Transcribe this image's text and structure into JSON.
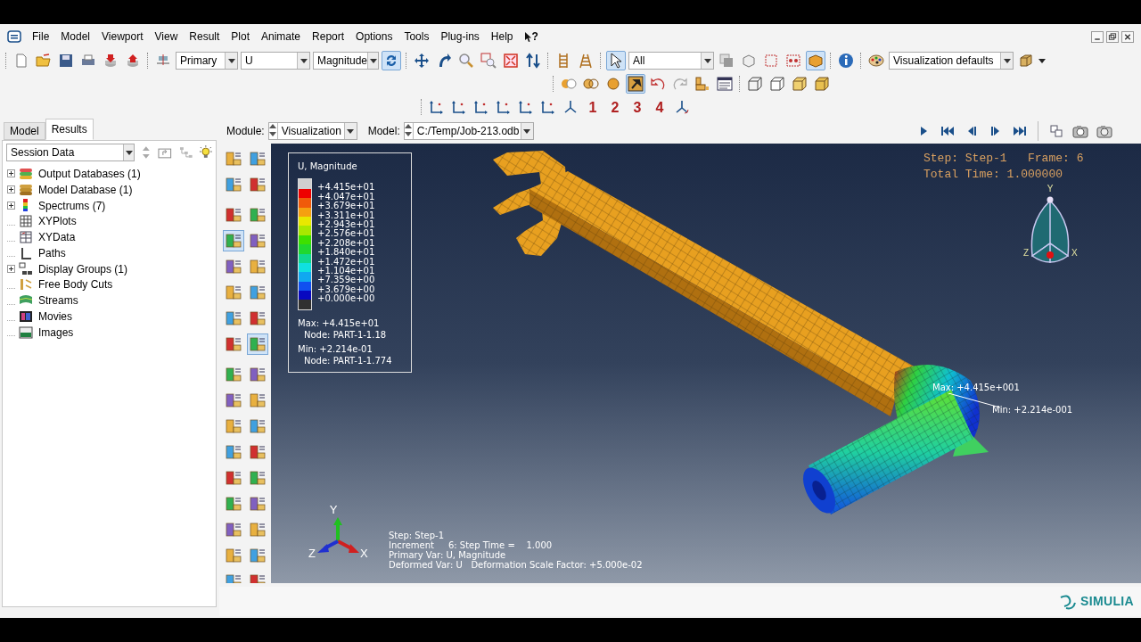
{
  "menu_bar": {
    "items": [
      "File",
      "Model",
      "Viewport",
      "View",
      "Result",
      "Plot",
      "Animate",
      "Report",
      "Options",
      "Tools",
      "Plug-ins",
      "Help"
    ],
    "help_mark": "?"
  },
  "toolbar": {
    "result_option": "Primary",
    "field": "U",
    "invariant": "Magnitude",
    "selection_filter": "All",
    "view_options": "Visualization defaults",
    "viewport_numbers": [
      "1",
      "2",
      "3",
      "4"
    ]
  },
  "context_bar": {
    "module_label": "Module:",
    "module": "Visualization",
    "model_label": "Model:",
    "model": "C:/Temp/Job-213.odb"
  },
  "tabs": [
    {
      "label": "Model",
      "selected": false
    },
    {
      "label": "Results",
      "selected": true
    }
  ],
  "tree": {
    "filter": "Session Data",
    "items": [
      {
        "label": "Output Databases (1)",
        "expandable": true
      },
      {
        "label": "Model Database (1)",
        "expandable": true
      },
      {
        "label": "Spectrums (7)",
        "expandable": true
      },
      {
        "label": "XYPlots",
        "expandable": false
      },
      {
        "label": "XYData",
        "expandable": false
      },
      {
        "label": "Paths",
        "expandable": false
      },
      {
        "label": "Display Groups (1)",
        "expandable": true
      },
      {
        "label": "Free Body Cuts",
        "expandable": false
      },
      {
        "label": "Streams",
        "expandable": false
      },
      {
        "label": "Movies",
        "expandable": false
      },
      {
        "label": "Images",
        "expandable": false
      }
    ]
  },
  "viewport": {
    "legend": {
      "title": "U, Magnitude",
      "spectrum": [
        {
          "color": "#d0d0d0"
        },
        {
          "color": "#ee0000"
        },
        {
          "color": "#f05a0a"
        },
        {
          "color": "#f5a010"
        },
        {
          "color": "#e8e800"
        },
        {
          "color": "#a8e800"
        },
        {
          "color": "#3ee000"
        },
        {
          "color": "#20d830"
        },
        {
          "color": "#10d890"
        },
        {
          "color": "#10e0e0"
        },
        {
          "color": "#10a8f0"
        },
        {
          "color": "#1050f0"
        },
        {
          "color": "#0808c0"
        },
        {
          "color": "#303030"
        }
      ],
      "labels": [
        "+4.415e+01",
        "+4.047e+01",
        "+3.679e+01",
        "+3.311e+01",
        "+2.943e+01",
        "+2.576e+01",
        "+2.208e+01",
        "+1.840e+01",
        "+1.472e+01",
        "+1.104e+01",
        "+7.359e+00",
        "+3.679e+00",
        "+0.000e+00"
      ],
      "max": "Max: +4.415e+01",
      "max_node": "Node: PART-1-1.18",
      "min": "Min: +2.214e-01",
      "min_node": "Node: PART-1-1.774"
    },
    "state_block": [
      "Step: Step-1   Frame: 6",
      "Total Time: 1.000000"
    ],
    "view_cube_labels": [
      "Y",
      "Z",
      "X"
    ],
    "model_annotations": [
      "Max: +4.415e+001",
      "Min: +2.214e-001"
    ],
    "triad_labels": [
      "Y",
      "Z",
      "X"
    ],
    "info_block": [
      "Step: Step-1",
      "Increment     6: Step Time =    1.000",
      "Primary Var: U, Magnitude",
      "Deformed Var: U   Deformation Scale Factor: +5.000e-02"
    ]
  },
  "footer": {
    "brand": "SIMULIA"
  }
}
